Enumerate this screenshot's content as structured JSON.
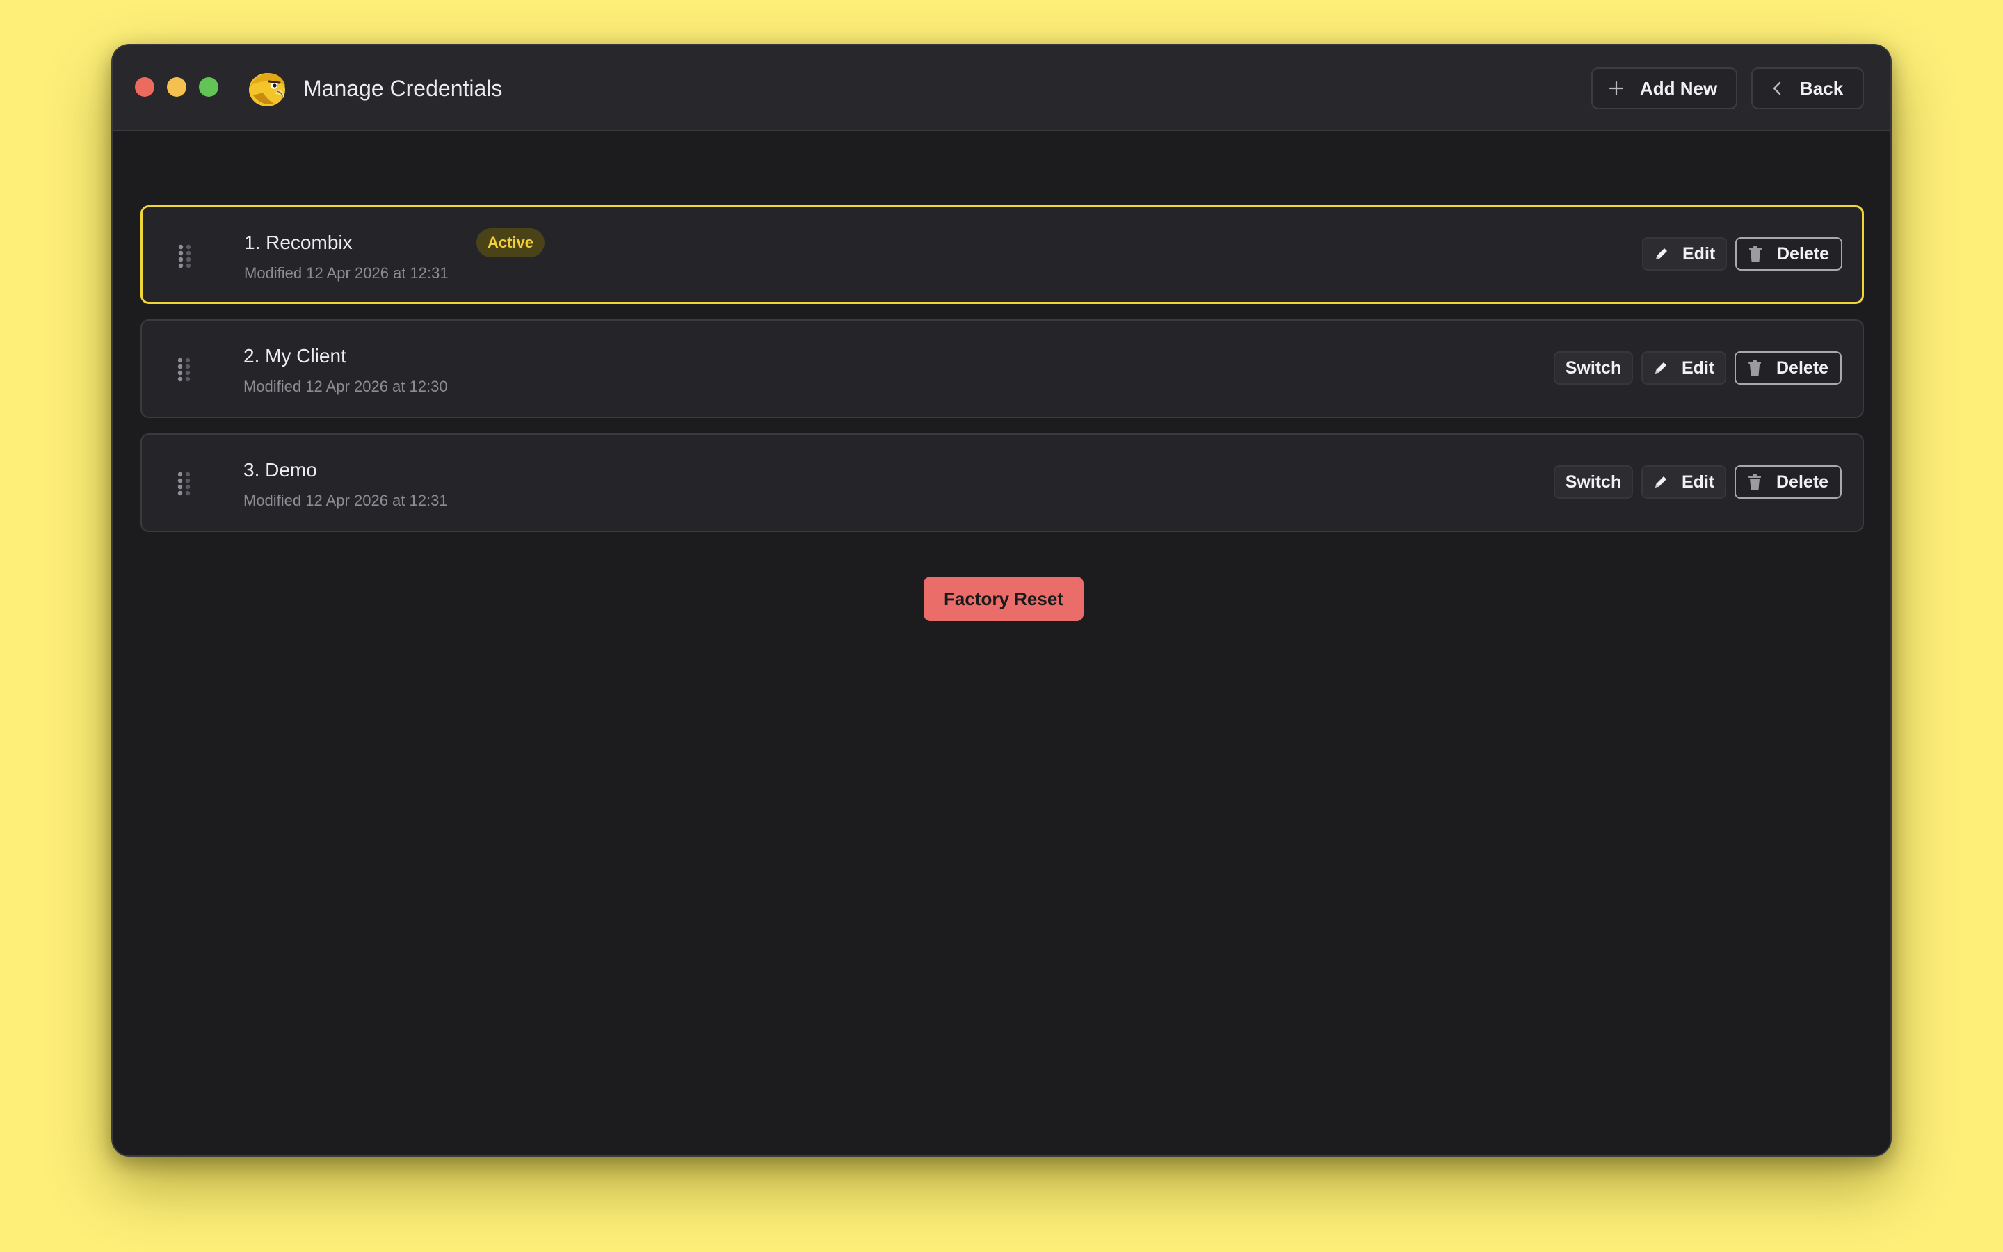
{
  "window": {
    "title": "Manage Credentials"
  },
  "header": {
    "add_label": "Add New",
    "back_label": "Back"
  },
  "credentials": [
    {
      "number": "1.",
      "name": "Recombix",
      "title": "1. Recombix",
      "badge": "Active",
      "modified": "Modified 12 Apr 2026 at 12:31",
      "active": true,
      "edit_label": "Edit",
      "delete_label": "Delete"
    },
    {
      "number": "2.",
      "name": "My Client",
      "title": "2. My Client",
      "modified": "Modified 12 Apr 2026 at 12:30",
      "active": false,
      "switch_label": "Switch",
      "edit_label": "Edit",
      "delete_label": "Delete"
    },
    {
      "number": "3.",
      "name": "Demo",
      "title": "3. Demo",
      "modified": "Modified 12 Apr 2026 at 12:31",
      "active": false,
      "switch_label": "Switch",
      "edit_label": "Edit",
      "delete_label": "Delete"
    }
  ],
  "footer": {
    "factory_reset_label": "Factory Reset"
  },
  "colors": {
    "background": "#fdef78",
    "window": "#1c1c1f",
    "card": "#252529",
    "accent_active": "#f0d53a",
    "danger": "#ea6d69"
  },
  "icons": {
    "app_logo": "eagle-logo-icon",
    "add": "plus-icon",
    "back": "chevron-left-icon",
    "drag": "drag-handle-icon",
    "edit": "pencil-icon",
    "delete": "trash-icon"
  }
}
